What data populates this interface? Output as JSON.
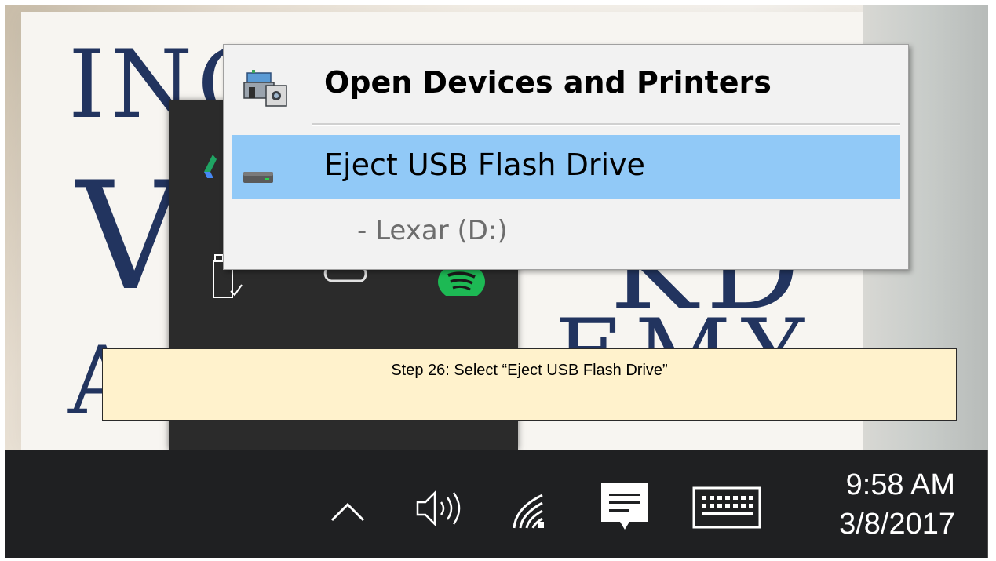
{
  "wallpaper": {
    "line1": "INC",
    "line2": "V",
    "line3": "A",
    "line4": "KD",
    "line5": "EMY"
  },
  "tray_flyout": {
    "icons": [
      "google-drive-icon",
      "usb-safely-remove-icon",
      "creative-cloud-icon",
      "spotify-icon"
    ]
  },
  "context_menu": {
    "items": [
      {
        "label": "Open Devices and Printers",
        "icon": "devices-printers-icon",
        "bold": true
      },
      {
        "label": "Eject USB Flash Drive",
        "icon": "usb-drive-icon",
        "highlighted": true
      },
      {
        "label": "-   Lexar (D:)",
        "sub": true
      }
    ]
  },
  "caption": {
    "text": "Step 26: Select “Eject USB Flash Drive”"
  },
  "taskbar": {
    "icons": [
      "chevron-up-icon",
      "volume-icon",
      "wifi-icon",
      "action-center-icon",
      "keyboard-icon"
    ],
    "time": "9:58 AM",
    "date": "3/8/2017"
  },
  "colors": {
    "menu_bg": "#f2f2f2",
    "menu_highlight": "#91c9f7",
    "taskbar_bg": "#1f2022",
    "caption_bg": "#fff2cc",
    "wallpaper_text": "#22345f"
  }
}
